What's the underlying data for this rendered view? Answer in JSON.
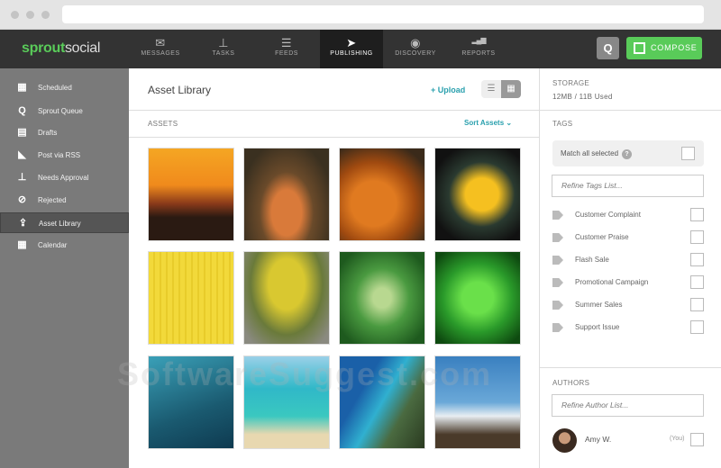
{
  "nav": {
    "logo_bold": "sprout",
    "logo_rest": "social",
    "items": [
      {
        "label": "MESSAGES",
        "icon": "envelope-icon",
        "glyph": "✉"
      },
      {
        "label": "TASKS",
        "icon": "pin-icon",
        "glyph": "⊥"
      },
      {
        "label": "FEEDS",
        "icon": "list-icon",
        "glyph": "☰"
      },
      {
        "label": "PUBLISHING",
        "icon": "paper-plane-icon",
        "glyph": "➤"
      },
      {
        "label": "DISCOVERY",
        "icon": "compass-icon",
        "glyph": "◉"
      },
      {
        "label": "REPORTS",
        "icon": "bar-chart-icon",
        "glyph": "▂▄▆"
      }
    ],
    "compose": "COMPOSE"
  },
  "sidebar": {
    "items": [
      {
        "label": "Scheduled",
        "glyph": "▦"
      },
      {
        "label": "Sprout Queue",
        "glyph": "Q"
      },
      {
        "label": "Drafts",
        "glyph": "▤"
      },
      {
        "label": "Post via RSS",
        "glyph": "◣"
      },
      {
        "label": "Needs Approval",
        "glyph": "⊥"
      },
      {
        "label": "Rejected",
        "glyph": "⊘"
      },
      {
        "label": "Asset Library",
        "glyph": "⇪"
      },
      {
        "label": "Calendar",
        "glyph": "▦"
      }
    ]
  },
  "main": {
    "title": "Asset Library",
    "upload": "+ Upload",
    "assets_label": "ASSETS",
    "sort": "Sort Assets ⌄"
  },
  "right": {
    "storage_label": "STORAGE",
    "storage_value": "12MB / 11B Used",
    "tags_label": "TAGS",
    "match_all": "Match all selected",
    "refine_tags": "Refine Tags List...",
    "tags": [
      "Customer Complaint",
      "Customer Praise",
      "Flash Sale",
      "Promotional Campaign",
      "Summer Sales",
      "Support Issue"
    ],
    "authors_label": "AUTHORS",
    "refine_authors": "Refine Author List...",
    "author": {
      "name": "Amy W.",
      "note": "(You)"
    }
  },
  "watermark": "SoftwareSuggest.com"
}
